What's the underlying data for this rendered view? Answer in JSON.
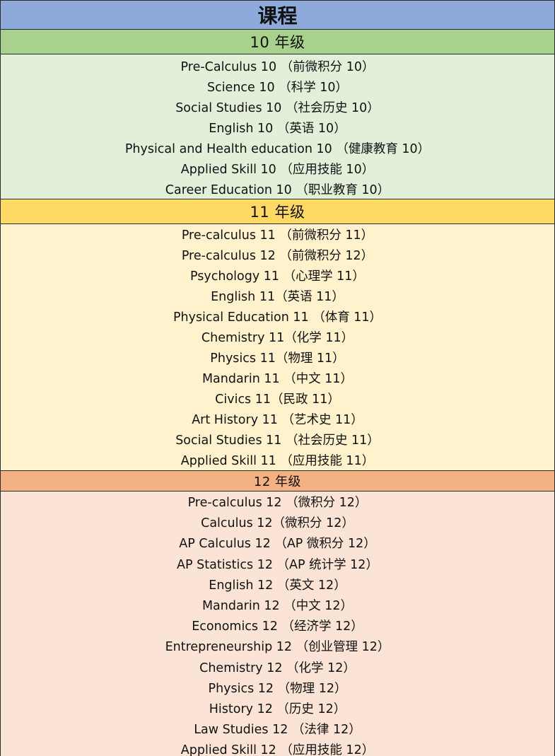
{
  "title": "课程",
  "grades": [
    {
      "header": "10 年级",
      "courses": [
        "Pre-Calculus 10 （前微积分 10）",
        "Science 10 （科学 10）",
        "Social Studies 10 （社会历史 10）",
        "English 10 （英语 10）",
        "Physical and Health education 10 （健康教育 10）",
        "Applied Skill 10 （应用技能 10）",
        "Career Education 10 （职业教育 10）"
      ]
    },
    {
      "header": "11 年级",
      "courses": [
        "Pre-calculus 11 （前微积分 11）",
        "Pre-calculus 12 （前微积分 12）",
        "Psychology 11 （心理学 11）",
        "English 11（英语 11）",
        "Physical Education 11 （体育 11）",
        "Chemistry 11（化学 11）",
        "Physics 11（物理 11）",
        "Mandarin 11 （中文 11）",
        "Civics 11（民政 11）",
        "Art History 11 （艺术史 11）",
        "Social Studies 11 （社会历史 11）",
        "Applied Skill 11 （应用技能 11）"
      ]
    },
    {
      "header": "12 年级",
      "courses": [
        "Pre-calculus 12 （微积分 12）",
        "Calculus 12（微积分 12）",
        "AP Calculus 12 （AP 微积分 12）",
        "AP Statistics 12 （AP 统计学 12）",
        "English 12 （英文 12）",
        "Mandarin 12 （中文 12）",
        "Economics 12 （经济学 12）",
        "Entrepreneurship 12 （创业管理 12）",
        "Chemistry 12 （化学 12）",
        "Physics 12 （物理 12）",
        "History 12 （历史 12）",
        "Law Studies 12 （法律 12）",
        "Applied Skill 12 （应用技能 12）"
      ]
    }
  ]
}
